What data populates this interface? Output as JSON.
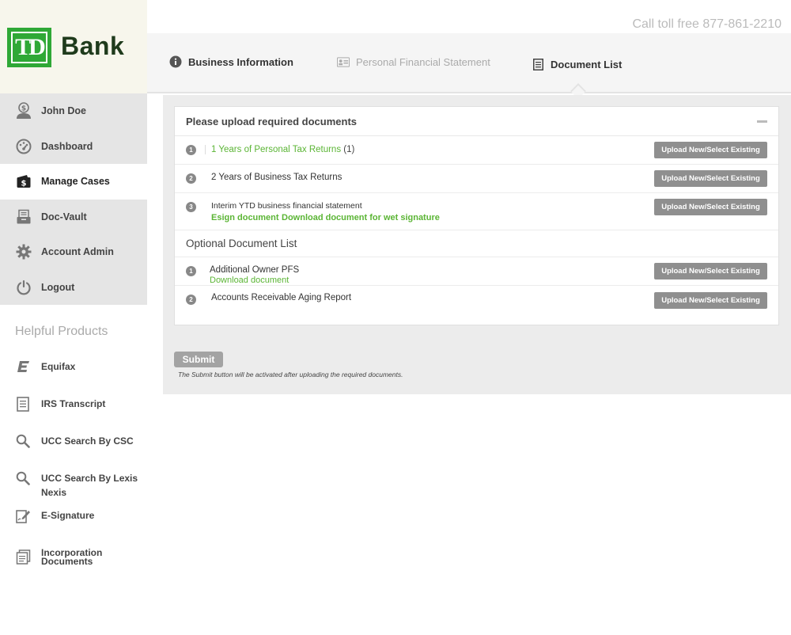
{
  "brand": {
    "logo_mark": "TD",
    "bank_name": "Bank"
  },
  "header": {
    "call_text": "Call toll free 877-861-2210"
  },
  "sidebar": {
    "items": [
      {
        "label": "John Doe",
        "icon": "user-dollar-icon"
      },
      {
        "label": "Dashboard",
        "icon": "dashboard-icon"
      },
      {
        "label": "Manage Cases",
        "icon": "wallet-icon",
        "active": true
      },
      {
        "label": "Doc-Vault",
        "icon": "vault-icon"
      },
      {
        "label": "Account Admin",
        "icon": "gear-icon"
      },
      {
        "label": "Logout",
        "icon": "power-icon"
      }
    ]
  },
  "helpful": {
    "title": "Helpful Products",
    "items": [
      {
        "label": "Equifax",
        "icon": "equifax-icon"
      },
      {
        "label": "IRS Transcript",
        "icon": "document-icon"
      },
      {
        "label": "UCC Search By CSC",
        "icon": "search-icon"
      },
      {
        "label_line1": "UCC Search By Lexis",
        "label_line2": "Nexis",
        "icon": "search-icon"
      },
      {
        "label": "E-Signature",
        "icon": "signature-icon"
      },
      {
        "label_line1": "Incorporation",
        "label_line2": "Documents",
        "icon": "documents-icon"
      }
    ]
  },
  "tabs": [
    {
      "label": "Business Information",
      "icon": "info-icon"
    },
    {
      "label": "Personal Financial Statement",
      "icon": "id-card-icon"
    },
    {
      "label": "Document List",
      "icon": "list-document-icon"
    }
  ],
  "required": {
    "title": "Please upload required documents",
    "docs": [
      {
        "num": "1",
        "label": "1 Years of Personal Tax Returns",
        "count": "(1)"
      },
      {
        "num": "2",
        "label": "2 Years of Business Tax Returns"
      },
      {
        "num": "3",
        "label": "Interim YTD business financial statement",
        "link1": "Esign document",
        "link2": "Download document for wet signature"
      }
    ],
    "upload_label": "Upload New/Select Existing"
  },
  "optional": {
    "title": "Optional Document List",
    "docs": [
      {
        "num": "1",
        "label": "Additional Owner PFS",
        "link": "Download document"
      },
      {
        "num": "2",
        "label": "Accounts Receivable Aging Report"
      }
    ]
  },
  "footer": {
    "submit_label": "Submit",
    "note": "The Submit button will be activated after uploading the required documents."
  },
  "colors": {
    "brand_green": "#2fa836",
    "link_green": "#5bb535",
    "button_gray": "#8f8f8f"
  }
}
